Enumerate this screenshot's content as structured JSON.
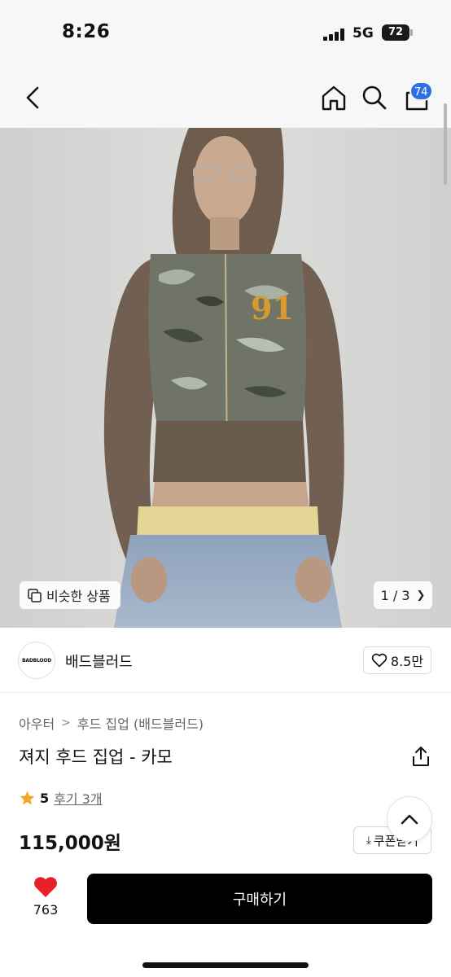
{
  "status_bar": {
    "time": "8:26",
    "network": "5G",
    "battery": "72"
  },
  "nav": {
    "back_icon": "chevron-left-icon",
    "home_icon": "home-icon",
    "search_icon": "search-icon",
    "cart_icon": "shopping-bag-icon",
    "cart_count": "74",
    "badge_color": "#2f6fe5"
  },
  "gallery": {
    "similar_label": "비슷한 상품",
    "pager": "1 / 3"
  },
  "brand": {
    "logo_text": "BADBLOOD",
    "name": "배드블러드",
    "likes": "8.5만"
  },
  "product": {
    "category": "아우터",
    "subcategory": "후드 집업 (배드블러드)",
    "title": "져지 후드 집업 - 카모",
    "rating": "5",
    "reviews": "후기 3개",
    "price": "115,000원",
    "coupon_label": "쿠폰받기"
  },
  "bottom": {
    "wish_count": "763",
    "buy_label": "구매하기",
    "accent_color": "#e8202a"
  }
}
